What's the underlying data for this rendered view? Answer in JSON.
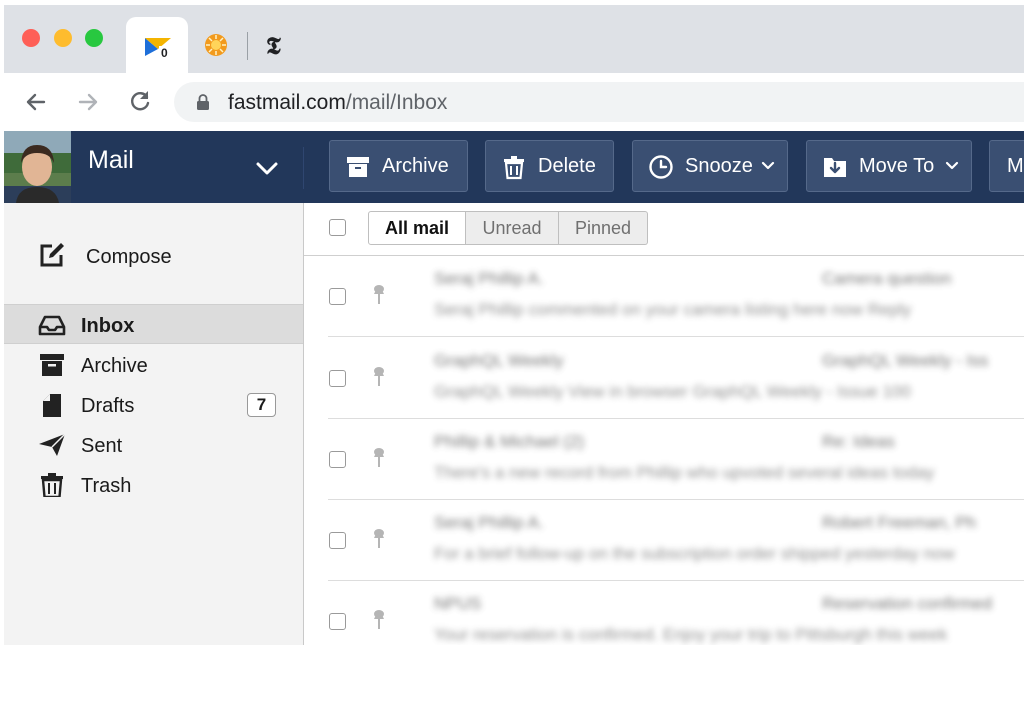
{
  "browser": {
    "url_host": "fastmail.com",
    "url_path": "/mail/Inbox",
    "tab_nyt_glyph": "𝕿"
  },
  "app": {
    "title": "Mail",
    "accent_color": "#22375a"
  },
  "toolbar": {
    "archive": "Archive",
    "delete": "Delete",
    "snooze": "Snooze",
    "move_to": "Move To",
    "more": "M"
  },
  "sidebar": {
    "compose": "Compose",
    "folders": [
      {
        "label": "Inbox",
        "icon": "inbox-icon",
        "active": true
      },
      {
        "label": "Archive",
        "icon": "archive-icon"
      },
      {
        "label": "Drafts",
        "icon": "drafts-icon",
        "badge": "7"
      },
      {
        "label": "Sent",
        "icon": "sent-icon"
      },
      {
        "label": "Trash",
        "icon": "trash-icon"
      }
    ]
  },
  "filters": {
    "all": "All mail",
    "unread": "Unread",
    "pinned": "Pinned"
  },
  "messages": [
    {
      "from": "Seraj Phillip A.",
      "subject": "Camera question",
      "preview": "Seraj Phillip commented on your camera listing here now Reply"
    },
    {
      "from": "GraphQL Weekly",
      "subject": "GraphQL Weekly - Iss",
      "preview": "GraphQL Weekly View in browser GraphQL Weekly - Issue 100"
    },
    {
      "from": "Phillip & Michael (2)",
      "subject": "Re: Ideas",
      "preview": "There's a new record from Phillip who upvoted several ideas today"
    },
    {
      "from": "Seraj Phillip A.",
      "subject": "Robert Freeman, Ph",
      "preview": "For a brief follow-up on the subscription order shipped yesterday now"
    },
    {
      "from": "NPUS",
      "subject": "Reservation confirmed",
      "preview": "Your reservation is confirmed. Enjoy your trip to Pittsburgh this week"
    }
  ]
}
